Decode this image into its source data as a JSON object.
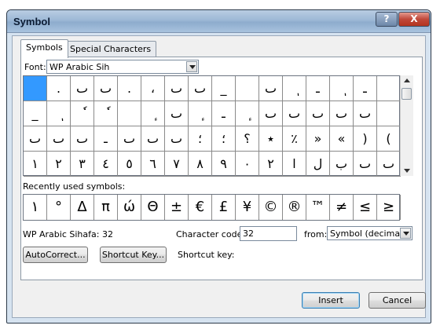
{
  "window": {
    "title": "Symbol",
    "help_label": "?",
    "close_label": "X"
  },
  "tabs": [
    {
      "label": "Symbols"
    },
    {
      "label": "Special Characters"
    }
  ],
  "font": {
    "label": "Font:",
    "value": "WP Arabic Sih"
  },
  "symbol_grid": {
    "selected_index": 0,
    "cells": [
      "",
      ".",
      "ٮ",
      "ٮ",
      ".",
      "،",
      "ٮ",
      "ٮ",
      "_",
      "",
      "ٮ",
      "ٖ",
      "ـ",
      "ٖ",
      "ـ",
      "",
      "_",
      "ٖ",
      "ٗ",
      "ٗ",
      "",
      "ٕ",
      "ٮ",
      "ٕ",
      "ـ",
      "ٕ",
      "ٮ",
      "ٮ",
      "ٮ",
      "ٮ",
      "ٮ",
      "",
      "ٮ",
      "ٮ",
      "ٮ",
      "ـ",
      "ٮ",
      "ٮ",
      "ٮ",
      "؛",
      "؛",
      "؟",
      "٭",
      "٪",
      "»",
      "«",
      ")",
      "(",
      "١",
      "٢",
      "٣",
      "٤",
      "٥",
      "٦",
      "٧",
      "٨",
      "٩",
      "٠",
      "٢",
      "ا",
      "ل",
      "ب",
      "ٮ",
      "ٮ"
    ]
  },
  "recent": {
    "label": "Recently used symbols:",
    "symbols": [
      "١",
      "°",
      "Δ",
      "π",
      "ώ",
      "Θ",
      "±",
      "€",
      "£",
      "¥",
      "©",
      "®",
      "™",
      "≠",
      "≤",
      "≥"
    ]
  },
  "info": {
    "char_name": "WP Arabic Sihafa: 32",
    "code_label": "Character code:",
    "code_value": "32",
    "from_label": "from:",
    "from_value": "Symbol (decimal)",
    "shortcut_label": "Shortcut key:"
  },
  "buttons": {
    "autocorrect": "AutoCorrect...",
    "shortcut_key": "Shortcut Key...",
    "insert": "Insert",
    "cancel": "Cancel"
  }
}
